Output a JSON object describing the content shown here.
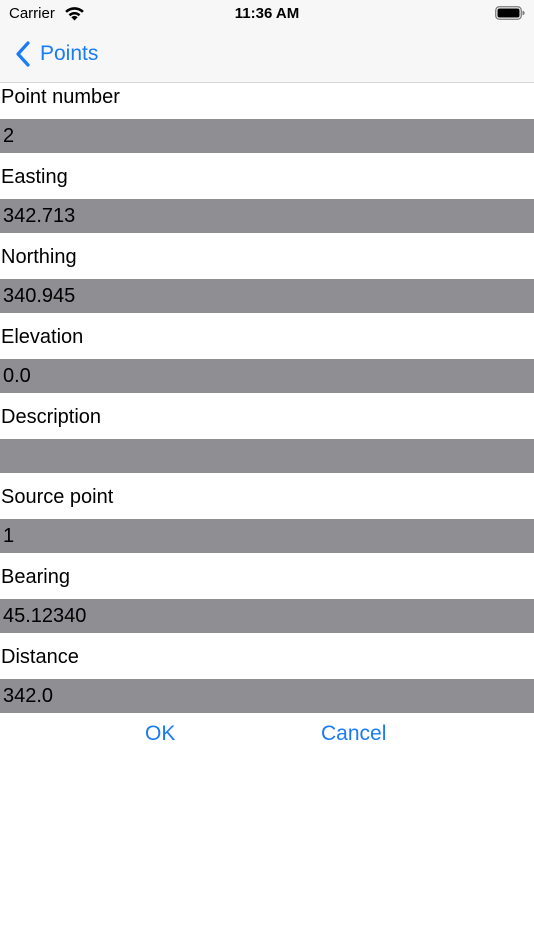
{
  "status_bar": {
    "carrier": "Carrier",
    "time": "11:36 AM"
  },
  "nav": {
    "back_label": "Points",
    "accent_color": "#1a7cf5"
  },
  "form": {
    "fields": [
      {
        "label": "Point number",
        "value": "2"
      },
      {
        "label": "Easting",
        "value": "342.713"
      },
      {
        "label": "Northing",
        "value": "340.945"
      },
      {
        "label": "Elevation",
        "value": "0.0"
      },
      {
        "label": "Description",
        "value": ""
      },
      {
        "label": "Source point",
        "value": "1"
      },
      {
        "label": "Bearing",
        "value": "45.12340"
      },
      {
        "label": "Distance",
        "value": "342.0"
      }
    ],
    "field_background": "#8e8e93"
  },
  "actions": {
    "ok_label": "OK",
    "cancel_label": "Cancel"
  }
}
